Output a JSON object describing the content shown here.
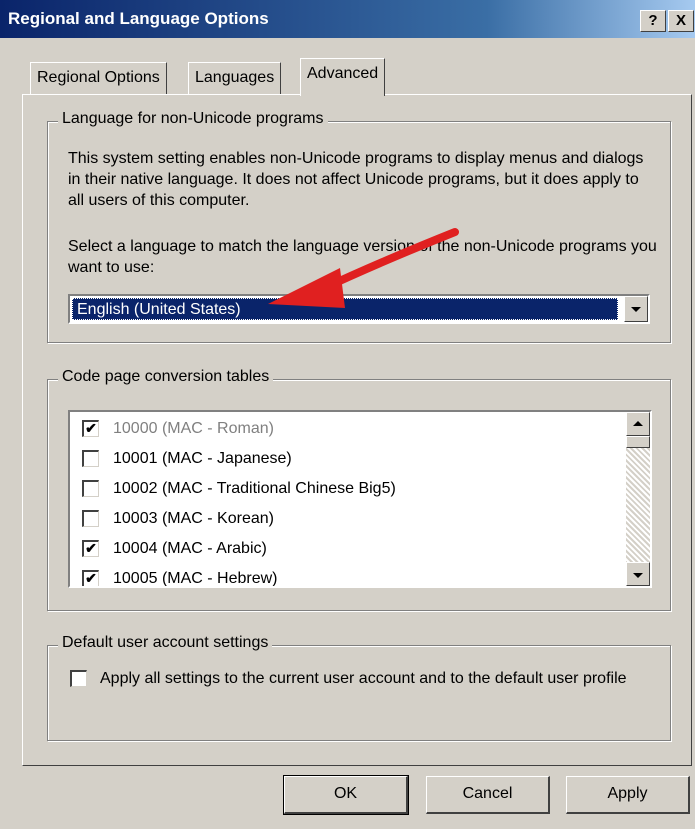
{
  "window": {
    "title": "Regional and Language Options",
    "help_label": "?",
    "close_label": "X"
  },
  "tabs": [
    {
      "label": "Regional Options",
      "active": false
    },
    {
      "label": "Languages",
      "active": false
    },
    {
      "label": "Advanced",
      "active": true
    }
  ],
  "non_unicode": {
    "legend": "Language for non-Unicode programs",
    "description": "This system setting enables non-Unicode programs to display menus and dialogs in their native language. It does not affect Unicode programs, but it does apply to all users of this computer.",
    "select_prompt": "Select a language to match the language version of the non-Unicode programs you want to use:",
    "selected_language": "English (United States)"
  },
  "code_pages": {
    "legend": "Code page conversion tables",
    "items": [
      {
        "label": "10000 (MAC - Roman)",
        "checked": true,
        "disabled": true
      },
      {
        "label": "10001 (MAC - Japanese)",
        "checked": false,
        "disabled": false
      },
      {
        "label": "10002 (MAC - Traditional Chinese Big5)",
        "checked": false,
        "disabled": false
      },
      {
        "label": "10003 (MAC - Korean)",
        "checked": false,
        "disabled": false
      },
      {
        "label": "10004 (MAC - Arabic)",
        "checked": true,
        "disabled": false
      },
      {
        "label": "10005 (MAC - Hebrew)",
        "checked": true,
        "disabled": false
      }
    ]
  },
  "default_user": {
    "legend": "Default user account settings",
    "checkbox_label": "Apply all settings to the current user account and to the default user profile",
    "checked": false
  },
  "buttons": {
    "ok": "OK",
    "cancel": "Cancel",
    "apply": "Apply"
  },
  "colors": {
    "title_bar": "#0a246a",
    "selection": "#0a246a",
    "annotation_arrow": "#e02020"
  }
}
